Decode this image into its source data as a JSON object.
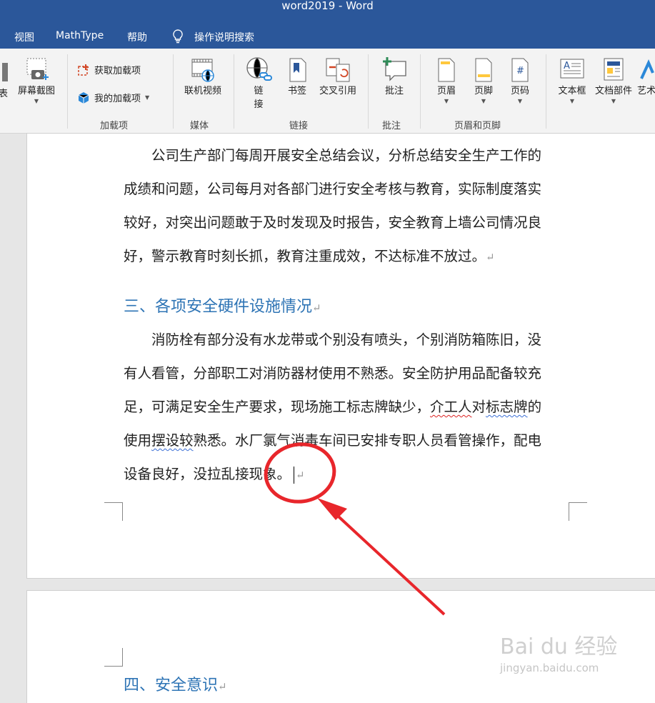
{
  "window": {
    "title": "word2019  -  Word"
  },
  "menu": {
    "items": [
      "视图",
      "MathType",
      "帮助"
    ],
    "search_label": "操作说明搜索"
  },
  "ribbon": {
    "partial_left_label": "表",
    "screenshot_label": "屏幕截图",
    "get_addins_label": "获取加载项",
    "my_addins_label": "我的加载项",
    "addins_group": "加载项",
    "online_video_label": "联机视频",
    "media_group": "媒体",
    "link_label_1": "链",
    "link_label_2": "接",
    "bookmark_label": "书签",
    "crossref_label": "交叉引用",
    "links_group": "链接",
    "comment_label": "批注",
    "comments_group": "批注",
    "header_label": "页眉",
    "footer_label": "页脚",
    "pagenum_label": "页码",
    "header_footer_group": "页眉和页脚",
    "textbox_label": "文本框",
    "quickparts_label": "文档部件",
    "wordart_label": "艺术"
  },
  "document": {
    "para1": [
      "　　公司生产部门每周开展安全总结会议，分析总结安全生产工作的",
      "成绩和问题，公司每月对各部门进行安全考核与教育，实际制度落实",
      "较好，对突出问题敢于及时发现及时报告，安全教育上墙公司情况良",
      "好，警示教育时刻长抓，教育注重成效，不达标准不放过。"
    ],
    "heading3": "三、各项安全硬件设施情况",
    "para2_line1": "　　消防栓有部分没有水龙带或个别没有喷头，个别消防箱陈旧，没",
    "para2_line2": "有人看管，分部职工对消防器材使用不熟悉。安全防护用品配备较充",
    "para2_line3_a": "足，可满足安全生产要求，现场施工标志牌缺少，",
    "para2_line3_b": "介工人",
    "para2_line3_c": "对",
    "para2_line3_d": "标志牌",
    "para2_line3_e": "的",
    "para2_line4_a": "使用",
    "para2_line4_b": "摆设较",
    "para2_line4_c": "熟悉。水厂氯气消毒车间已安排专职人员看管操作，配电",
    "para2_line5": "设备良好，没拉乱接现象。",
    "paragraph_mark": "↵",
    "heading4": "四、安全意识"
  },
  "watermark": {
    "main": "Bai du 经验",
    "sub": "jingyan.baidu.com"
  },
  "colors": {
    "brand": "#2b579a",
    "heading": "#2e74b5",
    "annotation": "#e8262b"
  }
}
